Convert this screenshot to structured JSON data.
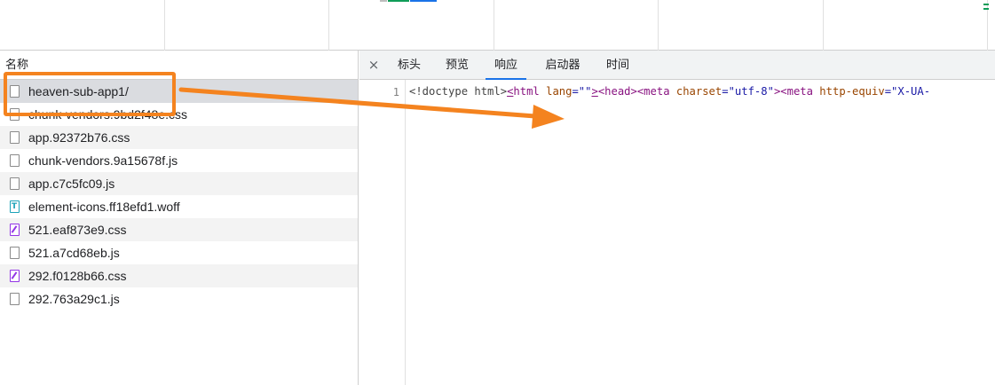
{
  "left_panel": {
    "header": "名称",
    "rows": [
      {
        "name": "heaven-sub-app1/",
        "icon": "document-icon"
      },
      {
        "name": "chunk-vendors.9bd2f48e.css",
        "icon": "document-icon"
      },
      {
        "name": "app.92372b76.css",
        "icon": "document-icon"
      },
      {
        "name": "chunk-vendors.9a15678f.js",
        "icon": "document-icon"
      },
      {
        "name": "app.c7c5fc09.js",
        "icon": "document-icon"
      },
      {
        "name": "element-icons.ff18efd1.woff",
        "icon": "font-file-icon"
      },
      {
        "name": "521.eaf873e9.css",
        "icon": "stylesheet-icon"
      },
      {
        "name": "521.a7cd68eb.js",
        "icon": "document-icon"
      },
      {
        "name": "292.f0128b66.css",
        "icon": "stylesheet-icon"
      },
      {
        "name": "292.763a29c1.js",
        "icon": "document-icon"
      }
    ]
  },
  "right_panel": {
    "close_label": "×",
    "tabs": [
      {
        "label": "标头",
        "active": false
      },
      {
        "label": "预览",
        "active": false
      },
      {
        "label": "响应",
        "active": true
      },
      {
        "label": "启动器",
        "active": false
      },
      {
        "label": "时间",
        "active": false
      }
    ],
    "code": {
      "line_number": "1",
      "segments": [
        {
          "text": "<!doctype html>",
          "cls": "c-punct"
        },
        {
          "text": "<",
          "cls": "c-tag c-u"
        },
        {
          "text": "html",
          "cls": "c-tag"
        },
        {
          "text": " lang",
          "cls": "c-attr"
        },
        {
          "text": "=\"\"",
          "cls": "c-val"
        },
        {
          "text": ">",
          "cls": "c-tag c-u"
        },
        {
          "text": "<head>",
          "cls": "c-tag"
        },
        {
          "text": "<meta",
          "cls": "c-tag"
        },
        {
          "text": " charset",
          "cls": "c-attr"
        },
        {
          "text": "=\"utf-8\"",
          "cls": "c-val"
        },
        {
          "text": ">",
          "cls": "c-tag"
        },
        {
          "text": "<meta",
          "cls": "c-tag"
        },
        {
          "text": " http-equiv",
          "cls": "c-attr"
        },
        {
          "text": "=\"X-UA-",
          "cls": "c-val"
        }
      ]
    }
  },
  "colors": {
    "annotation": "#f4831f",
    "active_tab_underline": "#1a73e8",
    "selected_row": "#dadce0"
  }
}
